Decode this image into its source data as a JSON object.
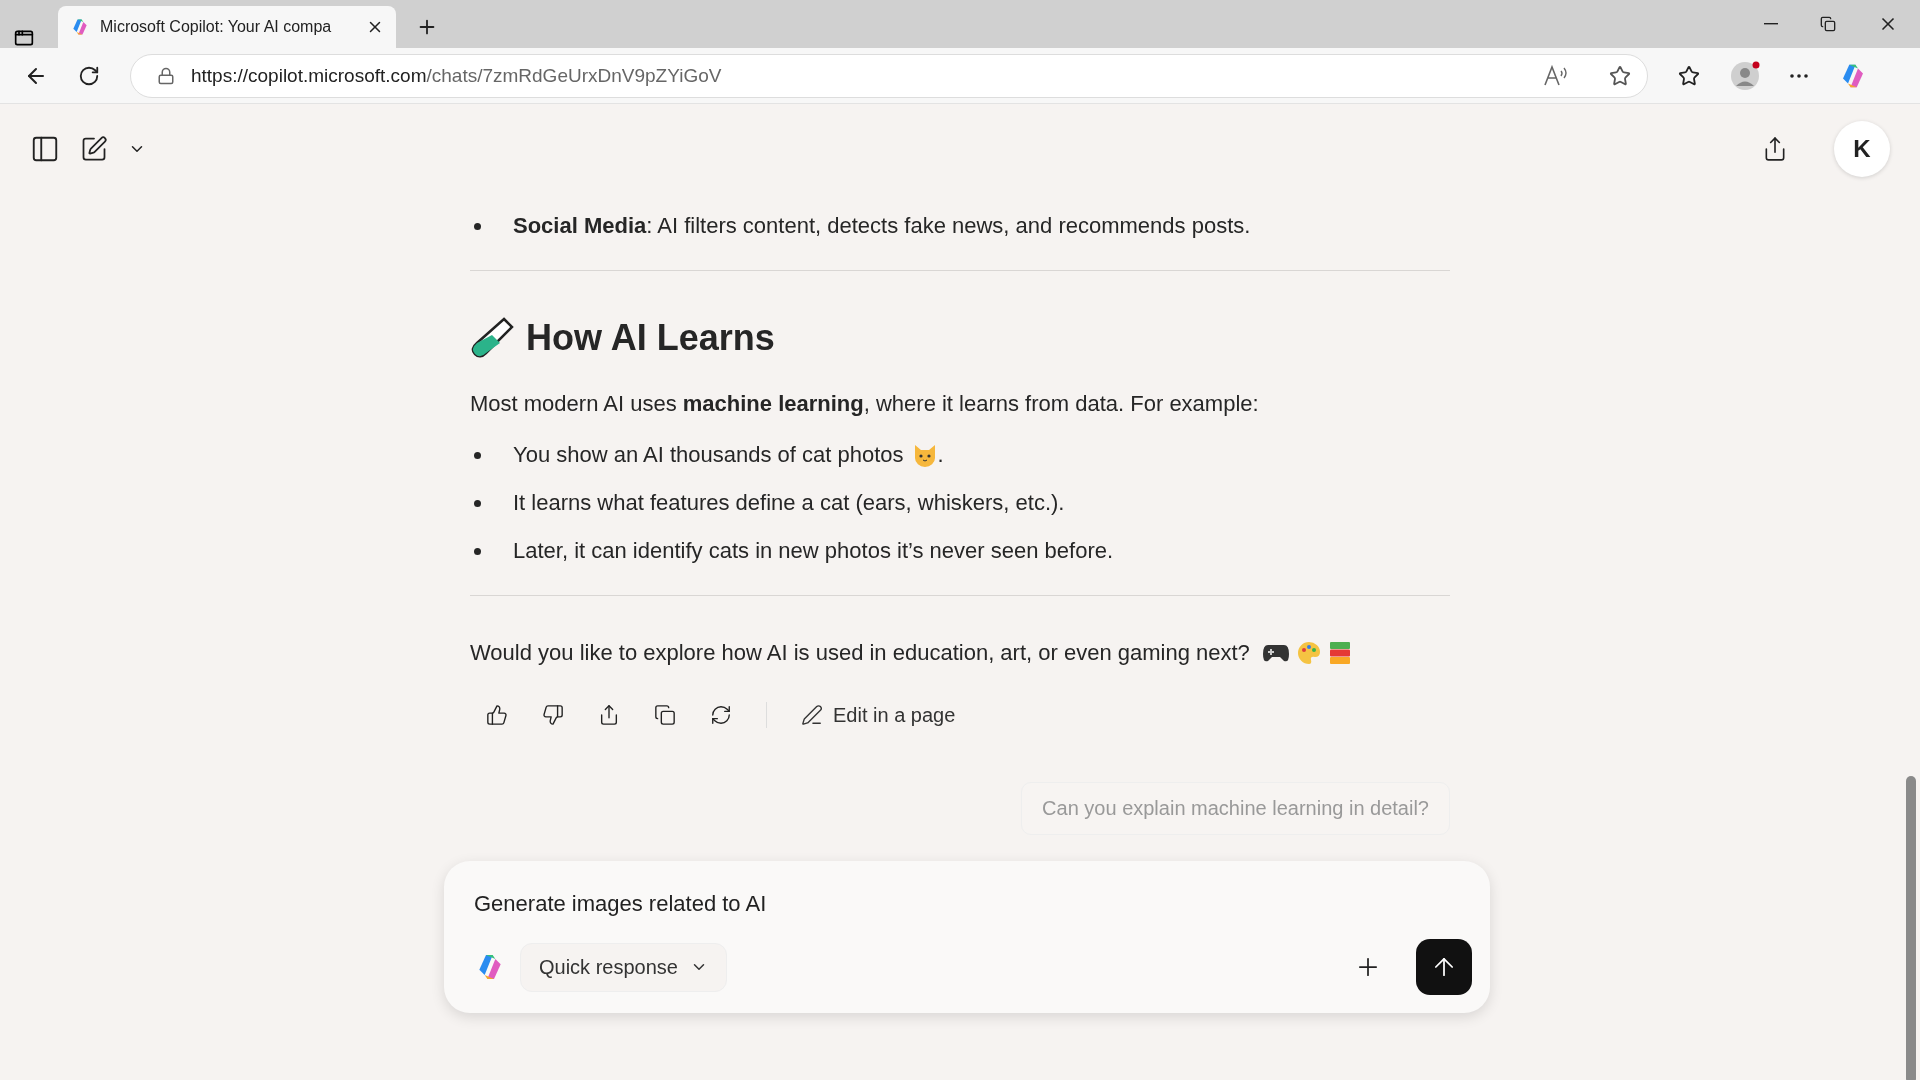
{
  "browser": {
    "tab_title": "Microsoft Copilot: Your AI compa",
    "url_host": "https://copilot.microsoft.com",
    "url_path": "/chats/7zmRdGeUrxDnV9pZYiGoV"
  },
  "header": {
    "avatar_letter": "K"
  },
  "chat": {
    "top_bullets": [
      {
        "bold": "Social Media",
        "text": ": AI filters content, detects fake news, and recommends posts."
      }
    ],
    "heading": "How AI Learns",
    "intro": "Most modern AI uses **machine learning**, where it learns from data. For example:",
    "bullets": [
      {
        "kind": "with-icon",
        "text": "You show an AI thousands of cat photos",
        "after": "."
      },
      {
        "kind": "plain",
        "text": "It learns what features define a cat (ears, whiskers, etc.)."
      },
      {
        "kind": "plain",
        "text": "Later, it can identify cats in new photos it’s never seen before."
      }
    ],
    "question": "Would you like to explore how AI is used in education, art, or even gaming next?",
    "edit_label": "Edit in a page",
    "suggestion": "Can you explain machine learning in detail?"
  },
  "composer": {
    "value": "Generate images related to AI",
    "mode": "Quick response"
  }
}
